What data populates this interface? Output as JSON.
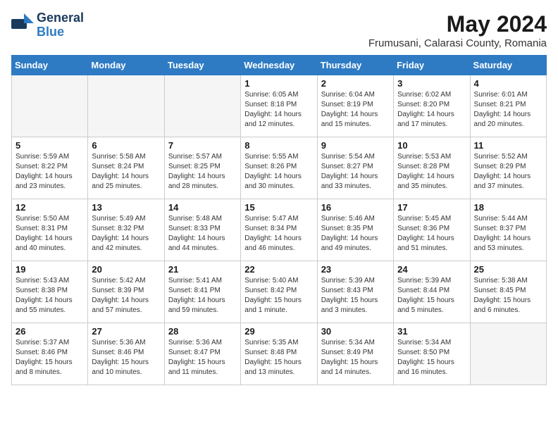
{
  "logo": {
    "general": "General",
    "blue": "Blue"
  },
  "title": "May 2024",
  "subtitle": "Frumusani, Calarasi County, Romania",
  "weekdays": [
    "Sunday",
    "Monday",
    "Tuesday",
    "Wednesday",
    "Thursday",
    "Friday",
    "Saturday"
  ],
  "weeks": [
    [
      {
        "day": "",
        "info": ""
      },
      {
        "day": "",
        "info": ""
      },
      {
        "day": "",
        "info": ""
      },
      {
        "day": "1",
        "info": "Sunrise: 6:05 AM\nSunset: 8:18 PM\nDaylight: 14 hours\nand 12 minutes."
      },
      {
        "day": "2",
        "info": "Sunrise: 6:04 AM\nSunset: 8:19 PM\nDaylight: 14 hours\nand 15 minutes."
      },
      {
        "day": "3",
        "info": "Sunrise: 6:02 AM\nSunset: 8:20 PM\nDaylight: 14 hours\nand 17 minutes."
      },
      {
        "day": "4",
        "info": "Sunrise: 6:01 AM\nSunset: 8:21 PM\nDaylight: 14 hours\nand 20 minutes."
      }
    ],
    [
      {
        "day": "5",
        "info": "Sunrise: 5:59 AM\nSunset: 8:22 PM\nDaylight: 14 hours\nand 23 minutes."
      },
      {
        "day": "6",
        "info": "Sunrise: 5:58 AM\nSunset: 8:24 PM\nDaylight: 14 hours\nand 25 minutes."
      },
      {
        "day": "7",
        "info": "Sunrise: 5:57 AM\nSunset: 8:25 PM\nDaylight: 14 hours\nand 28 minutes."
      },
      {
        "day": "8",
        "info": "Sunrise: 5:55 AM\nSunset: 8:26 PM\nDaylight: 14 hours\nand 30 minutes."
      },
      {
        "day": "9",
        "info": "Sunrise: 5:54 AM\nSunset: 8:27 PM\nDaylight: 14 hours\nand 33 minutes."
      },
      {
        "day": "10",
        "info": "Sunrise: 5:53 AM\nSunset: 8:28 PM\nDaylight: 14 hours\nand 35 minutes."
      },
      {
        "day": "11",
        "info": "Sunrise: 5:52 AM\nSunset: 8:29 PM\nDaylight: 14 hours\nand 37 minutes."
      }
    ],
    [
      {
        "day": "12",
        "info": "Sunrise: 5:50 AM\nSunset: 8:31 PM\nDaylight: 14 hours\nand 40 minutes."
      },
      {
        "day": "13",
        "info": "Sunrise: 5:49 AM\nSunset: 8:32 PM\nDaylight: 14 hours\nand 42 minutes."
      },
      {
        "day": "14",
        "info": "Sunrise: 5:48 AM\nSunset: 8:33 PM\nDaylight: 14 hours\nand 44 minutes."
      },
      {
        "day": "15",
        "info": "Sunrise: 5:47 AM\nSunset: 8:34 PM\nDaylight: 14 hours\nand 46 minutes."
      },
      {
        "day": "16",
        "info": "Sunrise: 5:46 AM\nSunset: 8:35 PM\nDaylight: 14 hours\nand 49 minutes."
      },
      {
        "day": "17",
        "info": "Sunrise: 5:45 AM\nSunset: 8:36 PM\nDaylight: 14 hours\nand 51 minutes."
      },
      {
        "day": "18",
        "info": "Sunrise: 5:44 AM\nSunset: 8:37 PM\nDaylight: 14 hours\nand 53 minutes."
      }
    ],
    [
      {
        "day": "19",
        "info": "Sunrise: 5:43 AM\nSunset: 8:38 PM\nDaylight: 14 hours\nand 55 minutes."
      },
      {
        "day": "20",
        "info": "Sunrise: 5:42 AM\nSunset: 8:39 PM\nDaylight: 14 hours\nand 57 minutes."
      },
      {
        "day": "21",
        "info": "Sunrise: 5:41 AM\nSunset: 8:41 PM\nDaylight: 14 hours\nand 59 minutes."
      },
      {
        "day": "22",
        "info": "Sunrise: 5:40 AM\nSunset: 8:42 PM\nDaylight: 15 hours\nand 1 minute."
      },
      {
        "day": "23",
        "info": "Sunrise: 5:39 AM\nSunset: 8:43 PM\nDaylight: 15 hours\nand 3 minutes."
      },
      {
        "day": "24",
        "info": "Sunrise: 5:39 AM\nSunset: 8:44 PM\nDaylight: 15 hours\nand 5 minutes."
      },
      {
        "day": "25",
        "info": "Sunrise: 5:38 AM\nSunset: 8:45 PM\nDaylight: 15 hours\nand 6 minutes."
      }
    ],
    [
      {
        "day": "26",
        "info": "Sunrise: 5:37 AM\nSunset: 8:46 PM\nDaylight: 15 hours\nand 8 minutes."
      },
      {
        "day": "27",
        "info": "Sunrise: 5:36 AM\nSunset: 8:46 PM\nDaylight: 15 hours\nand 10 minutes."
      },
      {
        "day": "28",
        "info": "Sunrise: 5:36 AM\nSunset: 8:47 PM\nDaylight: 15 hours\nand 11 minutes."
      },
      {
        "day": "29",
        "info": "Sunrise: 5:35 AM\nSunset: 8:48 PM\nDaylight: 15 hours\nand 13 minutes."
      },
      {
        "day": "30",
        "info": "Sunrise: 5:34 AM\nSunset: 8:49 PM\nDaylight: 15 hours\nand 14 minutes."
      },
      {
        "day": "31",
        "info": "Sunrise: 5:34 AM\nSunset: 8:50 PM\nDaylight: 15 hours\nand 16 minutes."
      },
      {
        "day": "",
        "info": ""
      }
    ]
  ]
}
